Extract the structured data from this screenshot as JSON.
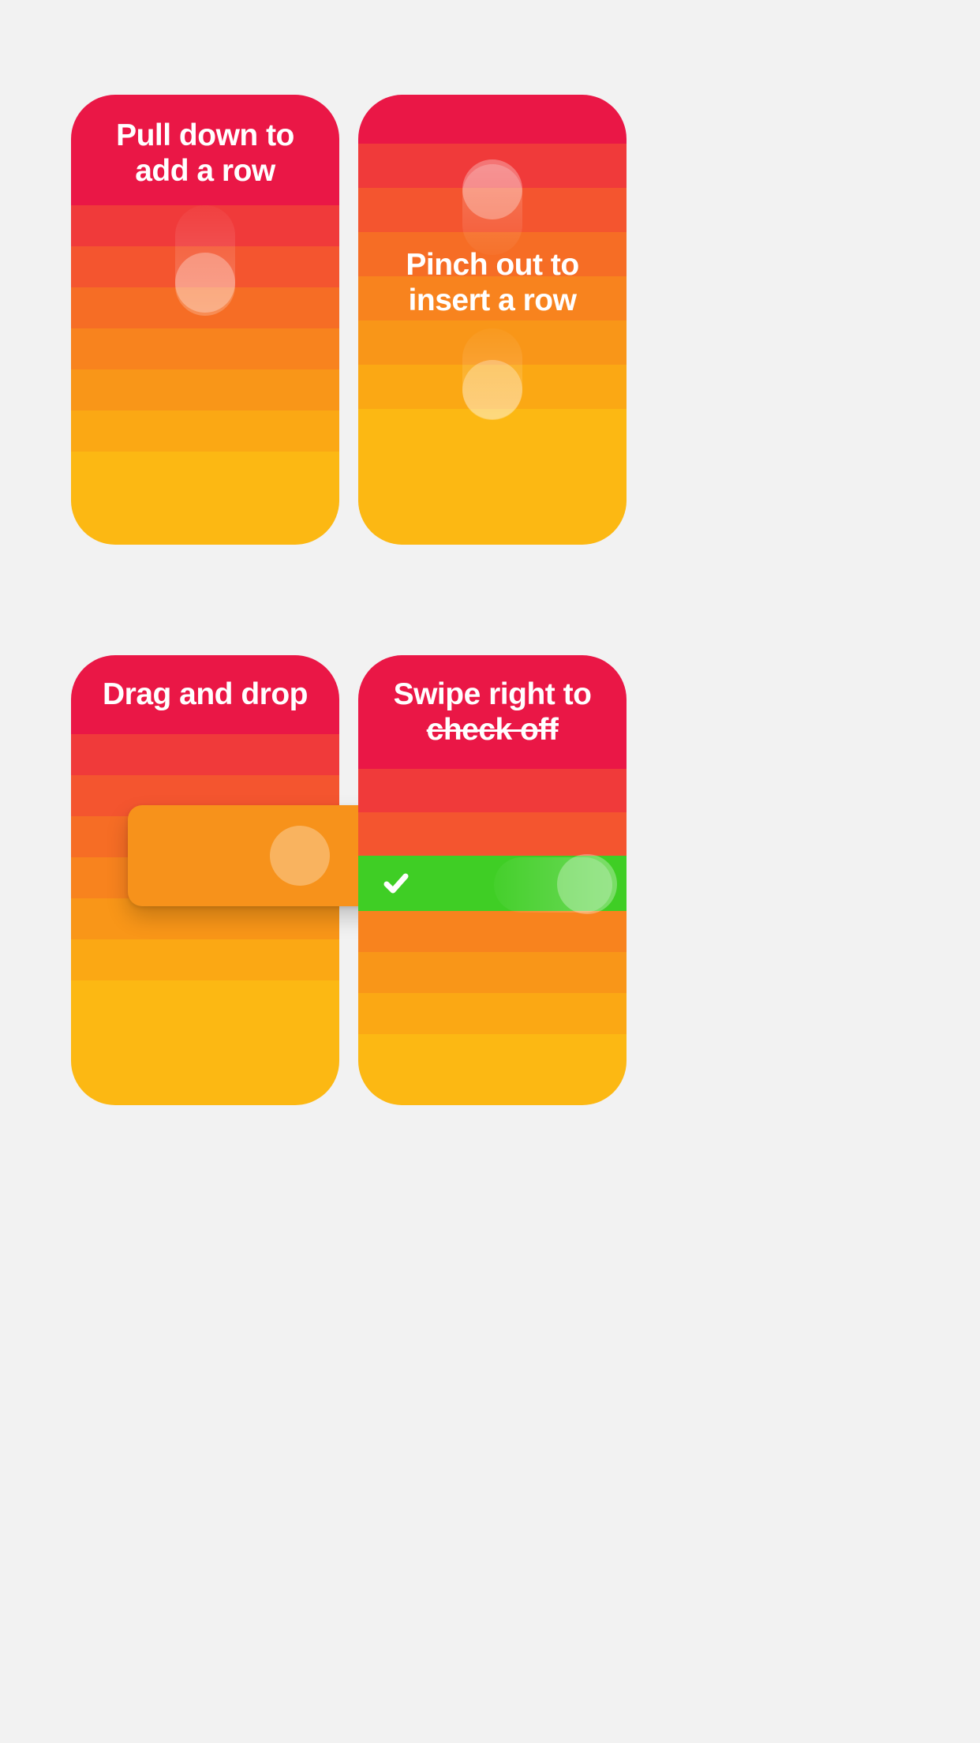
{
  "cards": [
    {
      "title_line1": "Pull down to",
      "title_line2": "add a row"
    },
    {
      "title_line1": "Pinch out to",
      "title_line2": "insert a row"
    },
    {
      "title_line1": "Drag and drop"
    },
    {
      "title_line1": "Swipe right to",
      "title_line2": "check off"
    }
  ],
  "colors": {
    "header": "#ea1746",
    "row1": "#f03a3a",
    "row2": "#f4552f",
    "row3": "#f66d25",
    "row4": "#f8831e",
    "row5": "#f99618",
    "row6": "#fba814",
    "row7": "#fcb813",
    "green": "#3fce25"
  }
}
